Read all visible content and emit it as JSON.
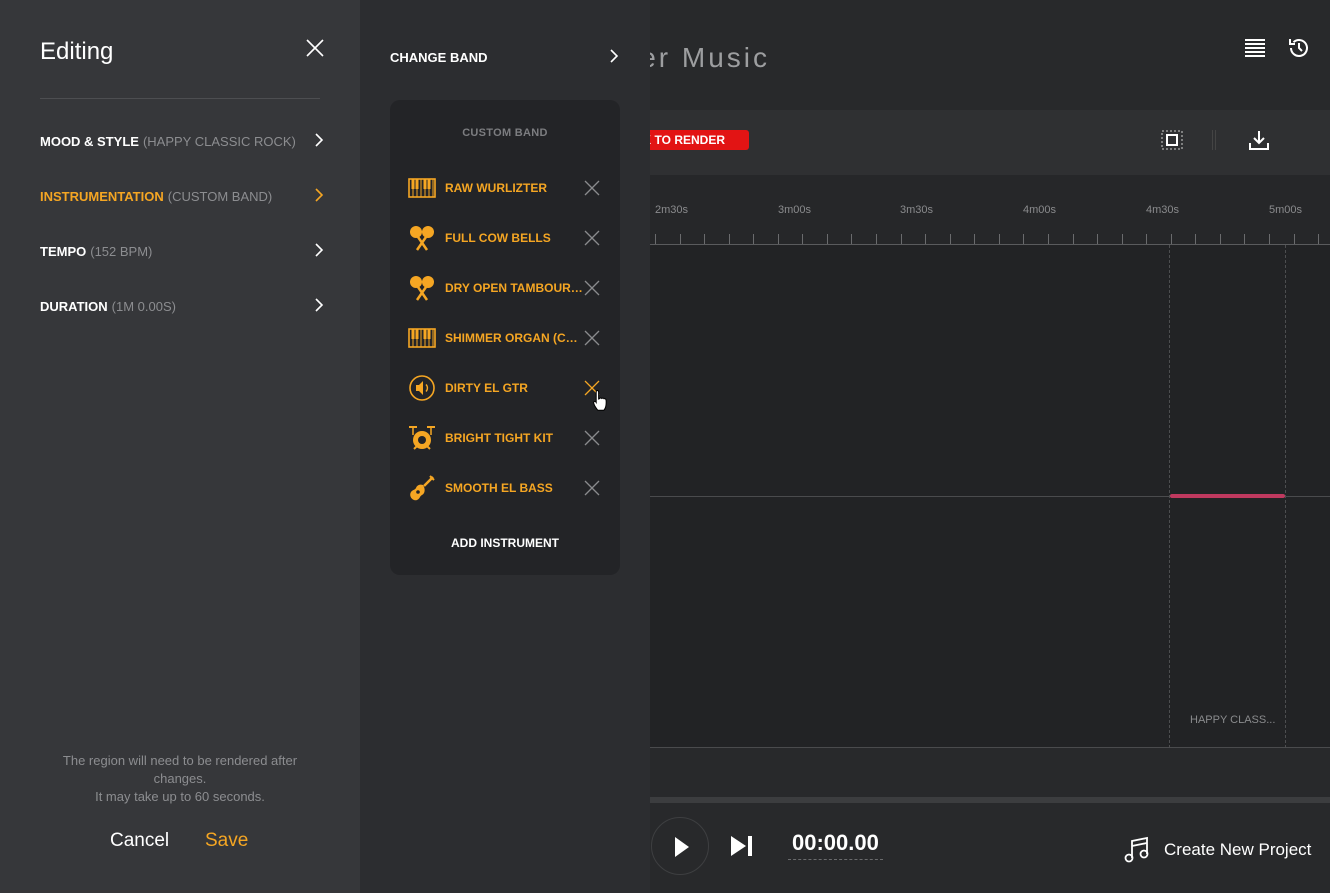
{
  "app": {
    "title_fragment": "er Music",
    "render_badge": "K TO RENDER",
    "timeline_ticks": [
      "2m30s",
      "3m00s",
      "3m30s",
      "4m00s",
      "4m30s",
      "5m00s"
    ],
    "region_label": "HAPPY CLASS...",
    "time": "00:00.00",
    "create_project": "Create New Project"
  },
  "edit": {
    "title": "Editing",
    "menu": [
      {
        "name": "MOOD & STYLE",
        "detail": "(HAPPY CLASSIC ROCK)"
      },
      {
        "name": "INSTRUMENTATION",
        "detail": "(CUSTOM BAND)"
      },
      {
        "name": "TEMPO",
        "detail": "(152 BPM)"
      },
      {
        "name": "DURATION",
        "detail": "(1M 0.00S)"
      }
    ],
    "note_line1": "The region will need to be rendered after changes.",
    "note_line2": "It may take up to 60 seconds.",
    "cancel": "Cancel",
    "save": "Save"
  },
  "band": {
    "change_band": "CHANGE BAND",
    "card_title": "CUSTOM BAND",
    "instruments": [
      {
        "label": "RAW WURLIZTER",
        "icon": "keyboard-icon"
      },
      {
        "label": "FULL COW BELLS",
        "icon": "maracas-icon"
      },
      {
        "label": "DRY OPEN TAMBOURINE",
        "icon": "maracas-icon"
      },
      {
        "label": "SHIMMER ORGAN (COM...",
        "icon": "keyboard-icon"
      },
      {
        "label": "DIRTY EL GTR",
        "icon": "speaker-icon"
      },
      {
        "label": "BRIGHT TIGHT KIT",
        "icon": "drum-kit-icon"
      },
      {
        "label": "SMOOTH EL BASS",
        "icon": "guitar-icon"
      }
    ],
    "add_instrument": "ADD INSTRUMENT"
  },
  "colors": {
    "accent": "#f5a623",
    "render_red": "#e21414",
    "region": "#c0395f"
  }
}
